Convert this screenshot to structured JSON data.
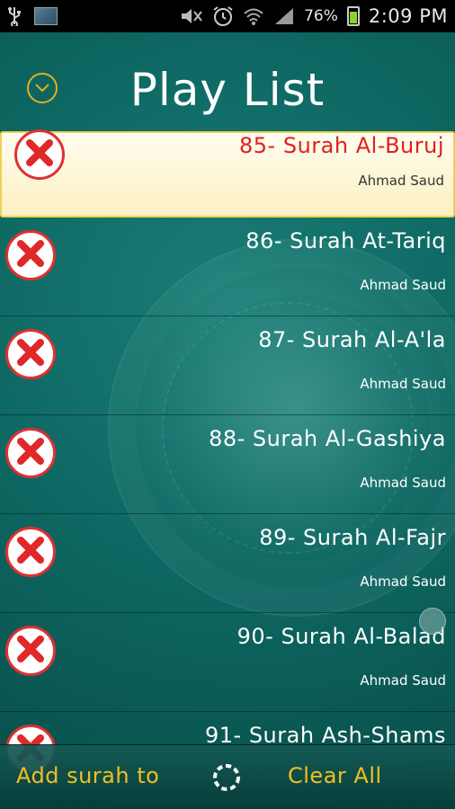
{
  "status_bar": {
    "battery_percent": "76%",
    "time": "2:09 PM",
    "icons": [
      "usb-icon",
      "image-thumbnail-icon",
      "mute-icon",
      "alarm-icon",
      "wifi-icon",
      "signal-icon",
      "battery-charging-icon"
    ]
  },
  "header": {
    "title": "Play List",
    "collapse_icon": "chevron-down-icon"
  },
  "playlist": [
    {
      "title": "85- Surah Al-Buruj",
      "artist": "Ahmad Saud",
      "selected": true
    },
    {
      "title": "86- Surah At-Tariq",
      "artist": "Ahmad Saud",
      "selected": false
    },
    {
      "title": "87- Surah Al-A'la",
      "artist": "Ahmad Saud",
      "selected": false
    },
    {
      "title": "88- Surah Al-Gashiya",
      "artist": "Ahmad Saud",
      "selected": false
    },
    {
      "title": "89- Surah Al-Fajr",
      "artist": "Ahmad Saud",
      "selected": false
    },
    {
      "title": "90- Surah Al-Balad",
      "artist": "Ahmad Saud",
      "selected": false
    },
    {
      "title": "91- Surah Ash-Shams",
      "artist": "",
      "selected": false
    }
  ],
  "bottom_bar": {
    "add_label": "Add surah to",
    "clear_label": "Clear All",
    "loading_icon": "loading-spinner-icon"
  },
  "colors": {
    "background": "#0a5f5a",
    "accent": "#f0c020",
    "selected_title": "#e02020",
    "remove_red": "#e03030"
  }
}
